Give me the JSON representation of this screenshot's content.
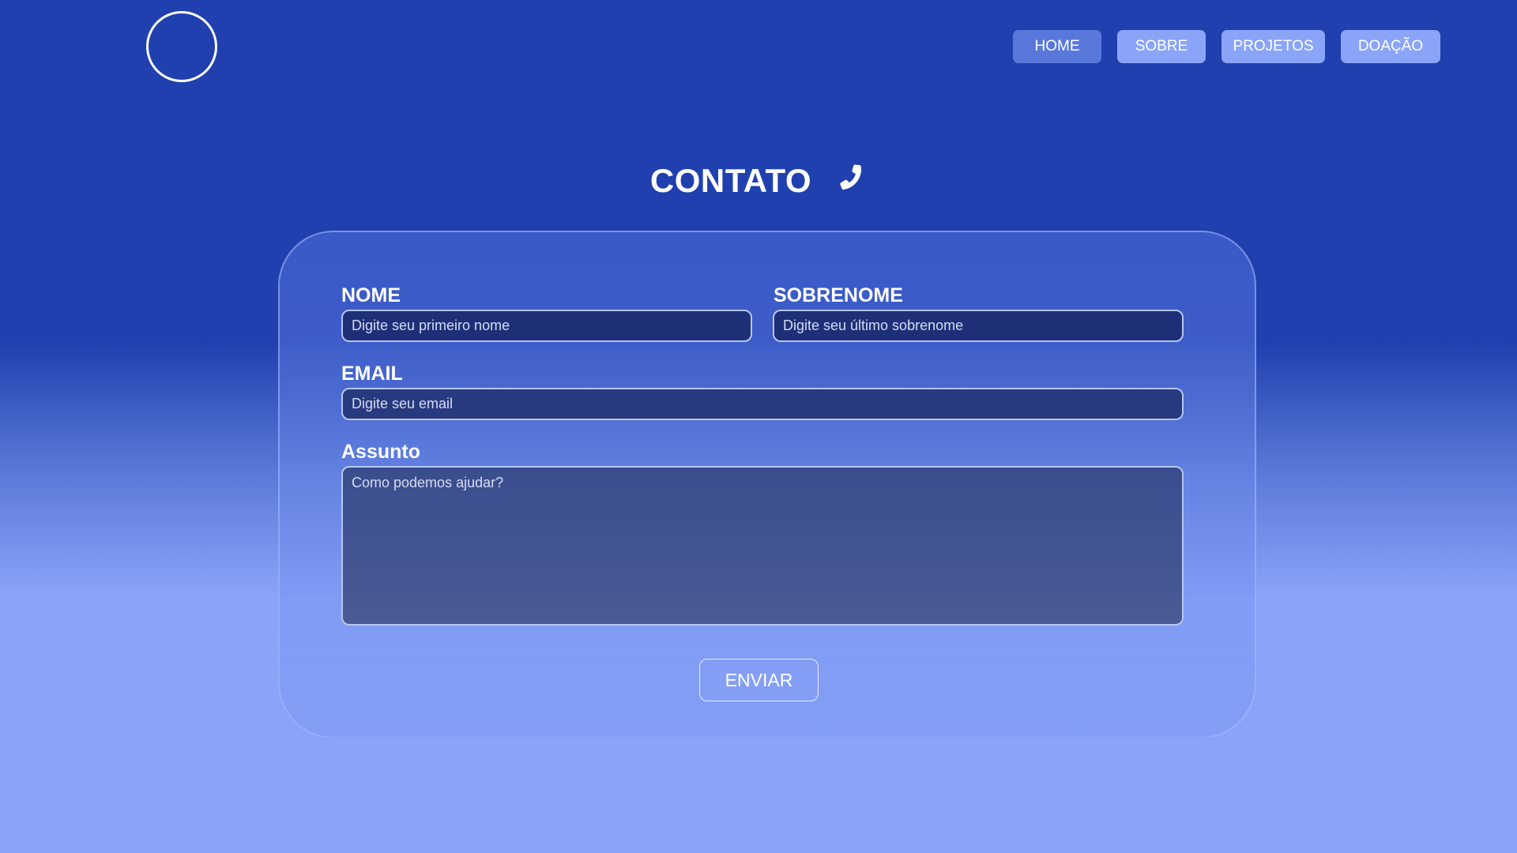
{
  "nav": {
    "items": [
      {
        "label": "HOME"
      },
      {
        "label": "SOBRE"
      },
      {
        "label": "PROJETOS"
      },
      {
        "label": "DOAÇÃO"
      }
    ]
  },
  "page": {
    "title": "CONTATO"
  },
  "form": {
    "nome_label": "NOME",
    "nome_placeholder": "Digite seu primeiro nome",
    "sobrenome_label": "SOBRENOME",
    "sobrenome_placeholder": "Digite seu último sobrenome",
    "email_label": "EMAIL",
    "email_placeholder": "Digite seu email",
    "assunto_label": "Assunto",
    "assunto_placeholder": "Como podemos ajudar?",
    "submit_label": "ENVIAR"
  },
  "icons": {
    "logo": "logo-circle",
    "title_icon": "phone-icon"
  },
  "colors": {
    "header_bg": "#1f40ae",
    "bottom_bg": "#8aa4f8",
    "active_nav": "#5878dc",
    "nav": "#8aa4f8"
  }
}
